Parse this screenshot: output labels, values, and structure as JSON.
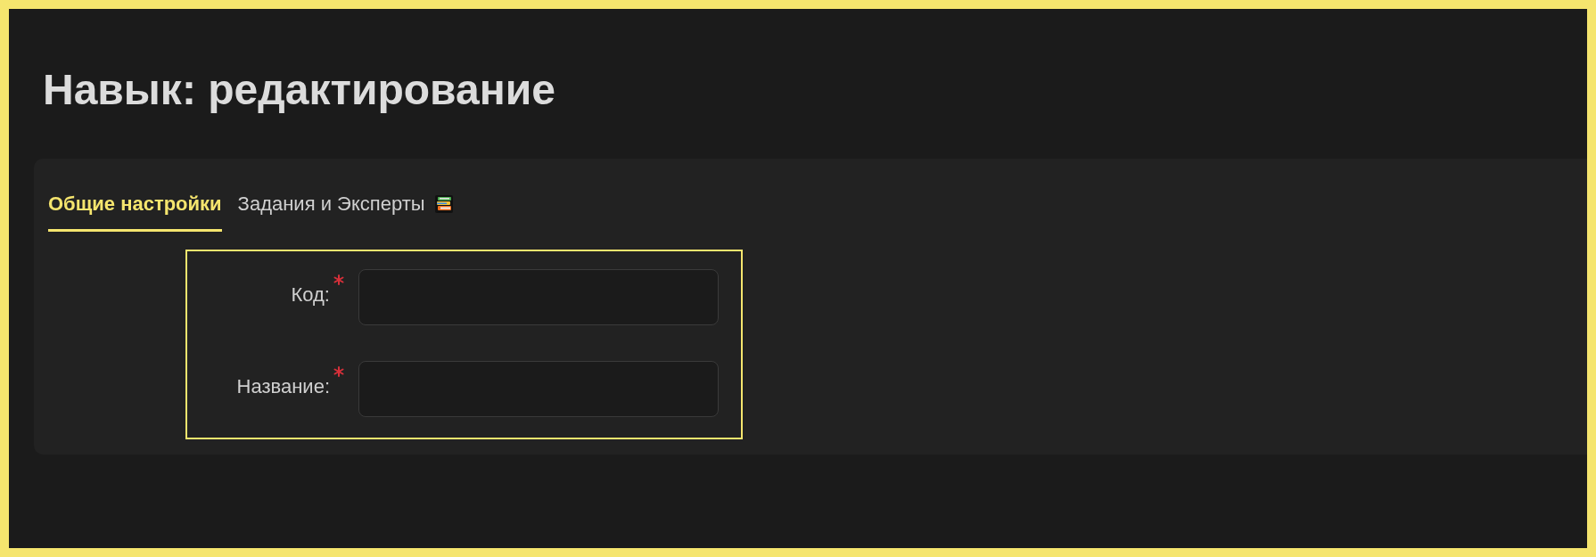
{
  "page": {
    "title": "Навык: редактирование"
  },
  "tabs": [
    {
      "label": "Общие настройки",
      "selected": true,
      "icon": false
    },
    {
      "label": "Задания и Эксперты",
      "selected": false,
      "icon": true
    }
  ],
  "fields": [
    {
      "label": "Код:",
      "required": true
    },
    {
      "label": "Название:",
      "required": true
    }
  ]
}
